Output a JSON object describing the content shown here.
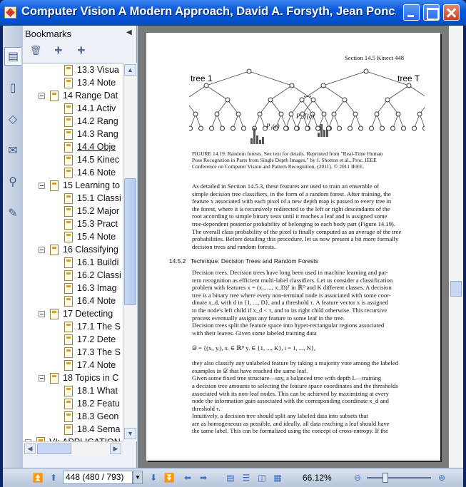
{
  "window": {
    "title": "Computer Vision A Modern Approach, David A. Forsyth, Jean Ponc..."
  },
  "panel": {
    "title": "Bookmarks",
    "toolbar": [
      "delete-bookmark",
      "new-bookmark",
      "bookmark-from-selection"
    ]
  },
  "rail_icons": [
    "bookmarks-icon",
    "pages-icon",
    "layers-icon",
    "comments-icon",
    "attachments-icon",
    "signatures-icon"
  ],
  "bookmarks": [
    {
      "label": "13.3 Visua",
      "level": 2
    },
    {
      "label": "13.4 Note",
      "level": 2
    },
    {
      "label": "14 Range Dat",
      "level": 1
    },
    {
      "label": "14.1 Activ",
      "level": 2
    },
    {
      "label": "14.2 Rang",
      "level": 2
    },
    {
      "label": "14.3 Rang",
      "level": 2
    },
    {
      "label": "14.4 Obje",
      "level": 2
    },
    {
      "label": "14.5 Kinec",
      "level": 2
    },
    {
      "label": "14.6 Note",
      "level": 2
    },
    {
      "label": "15 Learning to",
      "level": 1
    },
    {
      "label": "15.1 Classi",
      "level": 2
    },
    {
      "label": "15.2 Major",
      "level": 2
    },
    {
      "label": "15.3 Pract",
      "level": 2
    },
    {
      "label": "15.4 Note",
      "level": 2
    },
    {
      "label": "16 Classifying",
      "level": 1
    },
    {
      "label": "16.1 Buildi",
      "level": 2
    },
    {
      "label": "16.2 Classi",
      "level": 2
    },
    {
      "label": "16.3 Imag",
      "level": 2
    },
    {
      "label": "16.4 Note",
      "level": 2
    },
    {
      "label": "17 Detecting",
      "level": 1
    },
    {
      "label": "17.1 The S",
      "level": 2
    },
    {
      "label": "17.2 Dete",
      "level": 2
    },
    {
      "label": "17.3 The S",
      "level": 2
    },
    {
      "label": "17.4 Note",
      "level": 2
    },
    {
      "label": "18 Topics in C",
      "level": 1
    },
    {
      "label": "18.1 What",
      "level": 2
    },
    {
      "label": "18.2 Featu",
      "level": 2
    },
    {
      "label": "18.3 Geon",
      "level": 2
    },
    {
      "label": "18.4 Sema",
      "level": 2
    },
    {
      "label": "VI: APPLICATION",
      "level": 0
    }
  ],
  "document": {
    "running_head": "Section 14.5     Kinect     448",
    "figure_labels": {
      "tree1": "tree 1",
      "treeT": "tree T",
      "dots": "...",
      "p1": "P₁(c)",
      "pt": "P_T(c)"
    },
    "caption": [
      "FIGURE 14.19: Random forests. See text for details. Reprinted from \"Real-Time Human",
      "Pose Recognition in Parts from Single Depth Images,\" by J. Shotton et al., Proc. IEEE",
      "Conference on Computer Vision and Pattern Recognition, (2011). © 2011 IEEE."
    ],
    "para1": [
      "     As detailed in Section 14.5.3, these features are used to train an ensemble of",
      "simple decision tree classifiers, in the form of a random forest. After training, the",
      "feature x associated with each pixel of a new depth map is passed to every tree in",
      "the forest, where it is recursively redirected to the left or right descendants of the",
      "root according to simple binary tests until it reaches a leaf and is assigned some",
      "tree-dependent posterior probability of belonging to each body part (Figure 14.19).",
      "The overall class probability of the pixel is finally computed as an average of the tree",
      "probabilities. Before detailing this procedure, let us now present a bit more formally",
      "decision trees and random forests."
    ],
    "section_number": "14.5.2",
    "section_title": "Technique: Decision Trees and Random Forests",
    "para2": [
      "Decision trees. Decision trees have long been used in machine learning and pat-",
      "tern recognition as efficient multi-label classifiers. Let us consider a classification",
      "problem with features x = (x₁, ..., x_D)ᵀ in ℝᴰ and K different classes. A decision",
      "tree is a binary tree where every non-terminal node is associated with some coor-",
      "dinate x_d, with d in {1, ..., D}, and a threshold τ. A feature vector x is assigned",
      "to the node's left child if x_d < τ, and to its right child otherwise. This recursive",
      "process eventually assigns any feature to some leaf in the tree.",
      "     Decision trees split the feature space into hyper-rectangular regions associated",
      "with their leaves. Given some labeled training data",
      "",
      "              𝒟 = {(xᵢ, yᵢ), xᵢ ∈ ℝᴰ yᵢ ∈ {1, ..., K}, i = 1, ..., N},",
      "",
      "they also classify any unlabeled feature by taking a majority vote among the labeled",
      "examples in 𝒟 that have reached the same leaf.",
      "     Given some fixed tree structure—say, a balanced tree with depth L—training",
      "a decision tree amounts to selecting the feature space coordinates and the thresholds",
      "associated with its non-leaf nodes. This can be achieved by maximizing at every",
      "node the information gain associated with the corresponding coordinate x_d and",
      "threshold τ.",
      "     Intuitively, a decision tree should split any labeled data into subsets that",
      "are as homogeneous as possible, and ideally, all data reaching a leaf should have",
      "the same label. This can be formalized using the concept of cross-entropy. If the"
    ]
  },
  "statusbar": {
    "page_field": "448 (480 / 793)",
    "zoom": "66.12%"
  },
  "colors": {
    "titlebar": "#0858d8",
    "panel_bg": "#eef2f8",
    "viewer_bg": "#7a7a7a"
  }
}
